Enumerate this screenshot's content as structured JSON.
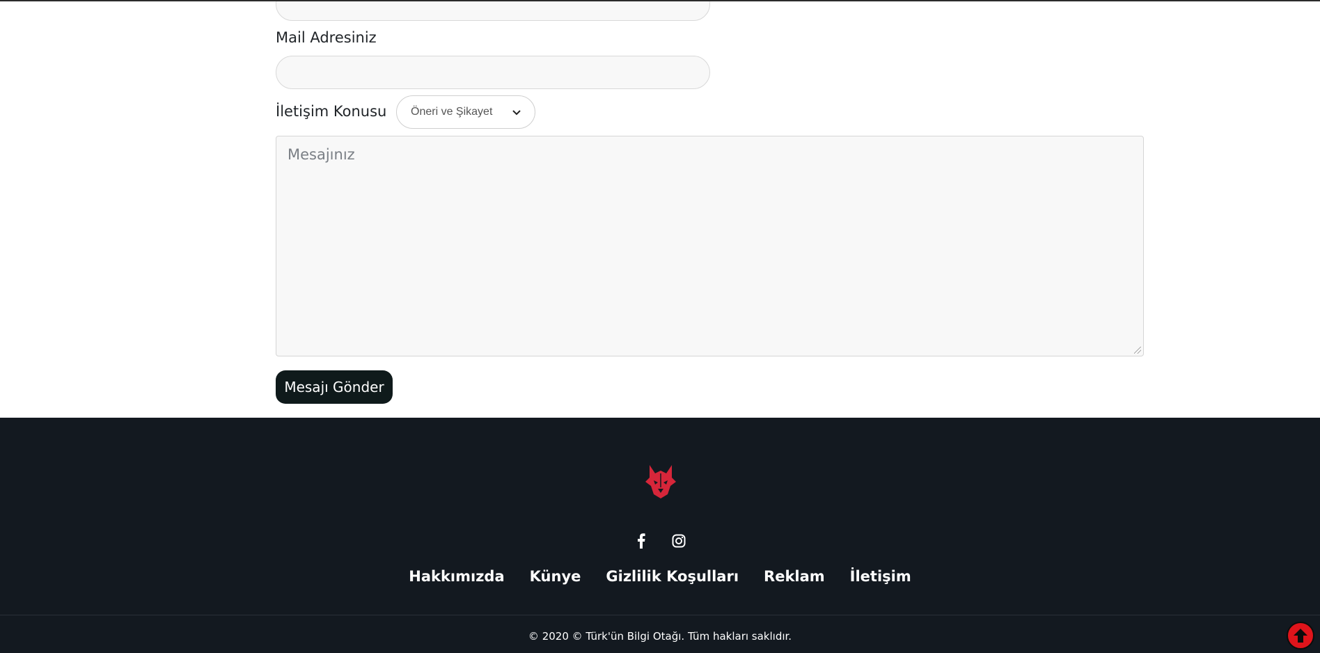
{
  "form": {
    "email_label": "Mail Adresiniz",
    "email_value": "",
    "topic_label": "İletişim Konusu",
    "topic_selected": "Öneri ve Şikayet",
    "message_placeholder": "Mesajınız",
    "send_label": "Mesajı Gönder"
  },
  "footer": {
    "logo_icon": "wolf-head-logo",
    "social": [
      {
        "name": "facebook-icon"
      },
      {
        "name": "instagram-icon"
      }
    ],
    "nav": [
      "Hakkımızda",
      "Künye",
      "Gizlilik Koşulları",
      "Reklam",
      "İletişim"
    ],
    "copyright": "© 2020 © Türk'ün Bilgi Otağı. Tüm hakları saklıdır.",
    "accent_color": "#e0141b",
    "background_color": "#131920"
  },
  "scroll_top_icon": "arrow-up-icon"
}
